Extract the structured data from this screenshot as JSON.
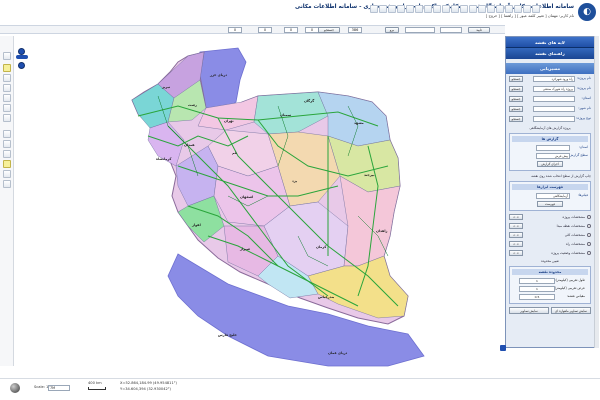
{
  "header": {
    "title": "سامانه اطلاعات مکانی آزمایشگاه فنی و مکانیک خاک وزارت راه و شهرسازی - سامانه اطلاعات مکانی",
    "subtitle": "نام کاربر: مهمان  [ تغییر کلمه عبور ]  [ راهنما ]  [ خروج ]"
  },
  "toolbar": {
    "coord1": "0",
    "coord2": "0",
    "coord3": "0",
    "coord4": "0",
    "goto_label": "برو",
    "zoom_value": "386",
    "search_label": "جستجو",
    "accept_label": "تایید"
  },
  "panel": {
    "tab_layers": "لایه های نقشه",
    "tab_legend": "راهنمای نقشه",
    "tab_route": "مسیریابی",
    "rows": [
      {
        "label": "نام پروژه:",
        "value": "راه ورود شهرکرد",
        "button": "جستجو"
      },
      {
        "label": "نام پروژه:",
        "value": "پروژه راه شهرک صنعتی",
        "button": "جستجو"
      },
      {
        "label": "استان:",
        "value": "",
        "button": "جستجو"
      },
      {
        "label": "نام شهر:",
        "value": "",
        "button": "جستجو"
      },
      {
        "label": "نوع پروژه:",
        "value": "",
        "button": "جستجو"
      }
    ],
    "filters_header": "پروژه گزارش های آزمایشگاهی",
    "report_section": {
      "title": "گزارش ها",
      "province_label": "استان:",
      "province_value": "",
      "level_label": "سطح گزارش:",
      "level_value": "پیش فرض",
      "run_button": "اجرای گزارش"
    },
    "checkbox_text": "چاپ گزارش از سطح انتخاب شده روی نقشه",
    "legend_section": {
      "title": "فهرست ابزارها",
      "select_label": "فیلترها:",
      "select_value": "آزمایشگاهی",
      "button": "فهرست"
    },
    "radios": [
      {
        "label": "مشخصات پروژه",
        "nav": "< <"
      },
      {
        "label": "مشخصات نقطه مبدا",
        "nav": "< <"
      },
      {
        "label": "مشخصات کلی",
        "nav": "< <"
      },
      {
        "label": "مشخصات راه",
        "nav": "< <"
      },
      {
        "label": "مشخصات وضعیت پروژه",
        "nav": "< <"
      }
    ],
    "range_label": "تعیین محدوده",
    "coords_title": "محدوده نقشه",
    "fields": [
      {
        "label": "طول تقریبی (کیلومتر):",
        "value": "1"
      },
      {
        "label": "عرض تقریبی (کیلومتر):",
        "value": "1"
      },
      {
        "label": "مقیاس نقشه:",
        "value": "0.5"
      }
    ],
    "btn_left": "نمایش تصاویر",
    "btn_right": "نمایش تصاویر ماهواره ای"
  },
  "status": {
    "scale_label": "Scale: 1/",
    "scale_value": "7M",
    "scale_bar_label": "400 km",
    "coord_line1": "X=52.864,184.99 (49.954811°)",
    "coord_line2": "Y=34.604,394 (32.930042°)"
  },
  "map": {
    "labels": {
      "caspian": "دریای خزر",
      "gulf": "خلیج فارس",
      "oman": "دریای عمان",
      "tehran": "تهران",
      "isfahan": "اصفهان",
      "mashhad": "مشهد",
      "shiraz": "شیراز",
      "zahedan": "زاهدان",
      "kerman": "کرمان",
      "yazd": "یزد",
      "semnan": "سمنان",
      "tabriz": "تبریز",
      "hamedan": "همدان",
      "ahvaz": "اهواز",
      "bandar": "بندرعباس",
      "qom": "قم",
      "kermanshah": "کرمانشاه",
      "birjand": "بیرجند",
      "rasht": "رشت",
      "gorgan": "گرگان"
    }
  },
  "colors": {
    "accent": "#1f4fa6",
    "panel_bg": "#e6ecf5",
    "road": "#2aa53b",
    "sea": "#8c8fe8"
  }
}
